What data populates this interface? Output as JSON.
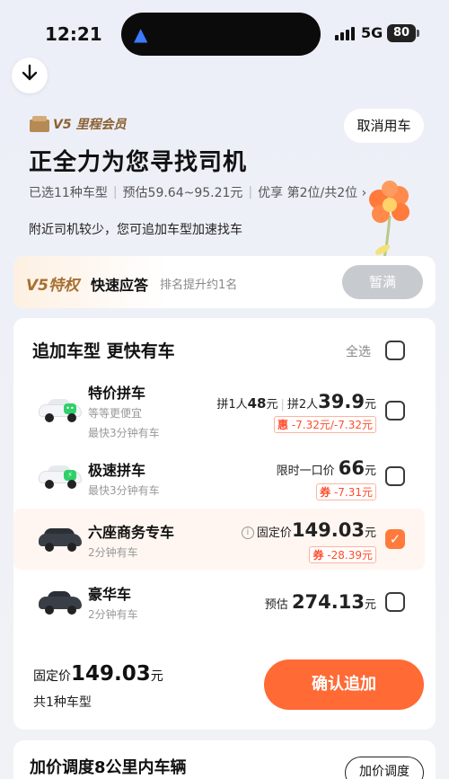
{
  "status": {
    "time": "12:21",
    "network": "5G",
    "battery": "80"
  },
  "header": {
    "member_label": "V5 里程会员",
    "cancel_button": "取消用车",
    "title": "正全力为您寻找司机",
    "selected_types": "已选11种车型",
    "estimate": "预估59.64~95.21元",
    "queue": "优享 第2位/共2位 ›",
    "notice": "附近司机较少，您可追加车型加速找车"
  },
  "v5_special": {
    "tag": "V5特权",
    "title": "快速应答",
    "subtitle": "排名提升约1名",
    "button": "暂满"
  },
  "add_car": {
    "title": "追加车型 更快有车",
    "select_all": "全选",
    "rows": [
      {
        "name": "特价拼车",
        "sub1": "等等更便宜",
        "sub2": "最快3分钟有车",
        "price_prefix_1": "拼1人",
        "price_1": "48",
        "price_unit_1": "元",
        "price_prefix_2": "拼2人",
        "price_2": "39.9",
        "price_unit_2": "元",
        "coupon_label": "惠",
        "coupon_value": "-7.32元/-7.32元",
        "checked": false
      },
      {
        "name": "极速拼车",
        "sub1": "最快3分钟有车",
        "price_prefix": "限时一口价",
        "price": "66",
        "price_unit": "元",
        "coupon_label": "券",
        "coupon_value": "-7.31元",
        "checked": false
      },
      {
        "name": "六座商务专车",
        "sub1": "2分钟有车",
        "price_prefix": "固定价",
        "price": "149.03",
        "price_unit": "元",
        "coupon_label": "券",
        "coupon_value": "-28.39元",
        "checked": true
      },
      {
        "name": "豪华车",
        "sub1": "2分钟有车",
        "price_prefix": "预估",
        "price": "274.13",
        "price_unit": "元",
        "checked": false
      }
    ],
    "footer": {
      "price_prefix": "固定价",
      "price": "149.03",
      "price_unit": "元",
      "count": "共1种车型",
      "confirm_button": "确认追加"
    }
  },
  "bottom": {
    "title": "加价调度8公里内车辆",
    "button": "加价调度"
  },
  "colors": {
    "accent": "#ff6a35",
    "coupon": "#ff4d2e",
    "gold": "#a86f32"
  }
}
